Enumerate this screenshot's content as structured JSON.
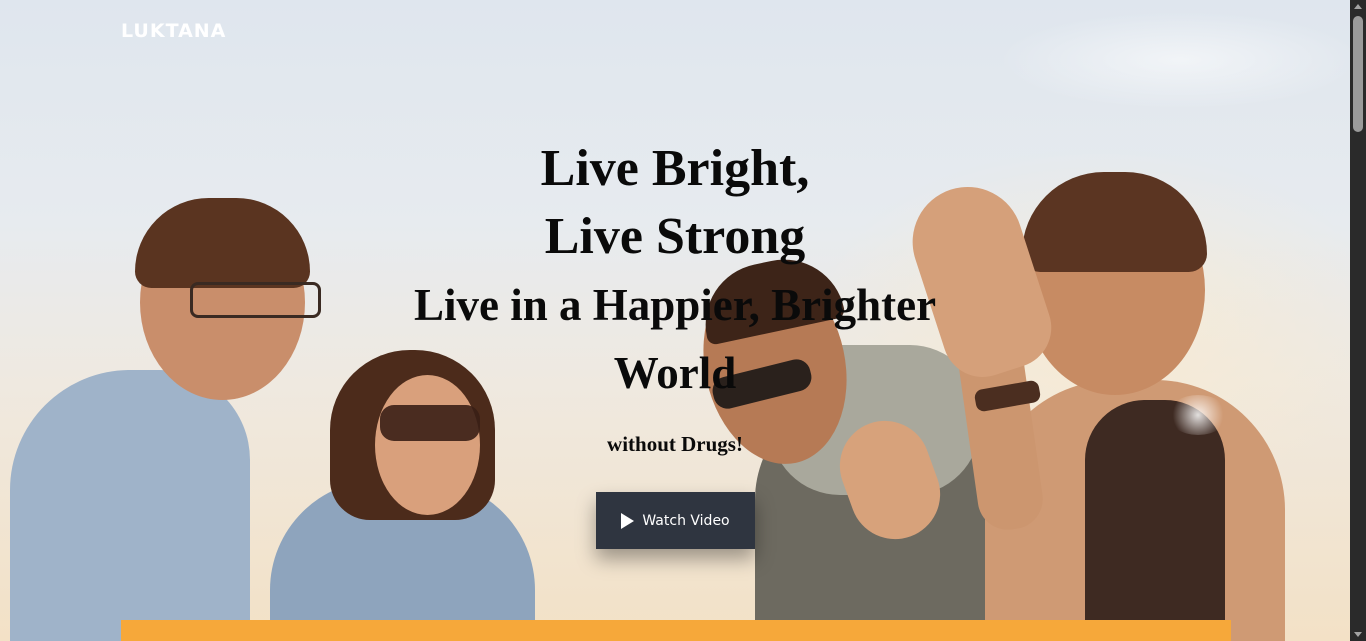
{
  "header": {
    "brand": "LUKTANA"
  },
  "hero": {
    "headline_line1": "Live Bright,",
    "headline_line2": "Live Strong",
    "headline_line3": "Live in a Happier, Brighter",
    "headline_line4": "World",
    "tagline": "without Drugs!",
    "cta_label": "Watch Video",
    "cta_icon": "play-icon"
  },
  "colors": {
    "button_bg": "#2f3540",
    "accent_bar": "#f6a83a",
    "brand_text": "#ffffff",
    "headline_text": "#0a0a0a"
  }
}
